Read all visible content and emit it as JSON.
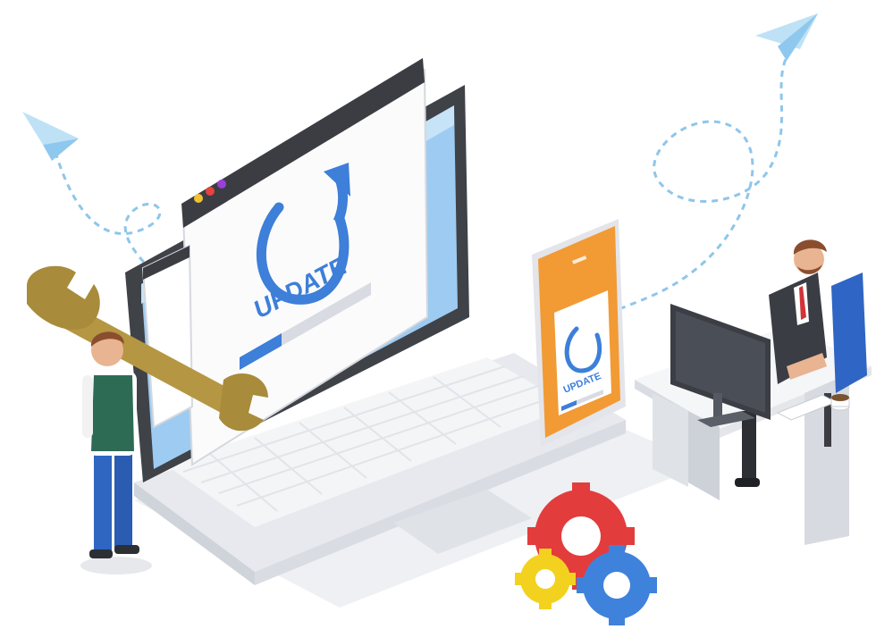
{
  "illustration": {
    "main_window": {
      "label": "UPDATE",
      "progress": 0.32,
      "dots": [
        "#f2c233",
        "#e6433c",
        "#9b3fd6"
      ]
    },
    "phone": {
      "label": "UPDATE",
      "progress": 0.35
    },
    "colors": {
      "accent_blue": "#3d7fd9",
      "light_blue": "#8ec0ee",
      "phone_orange": "#f29a34",
      "gear_red": "#e33c3c",
      "gear_blue": "#3f82dc",
      "gear_yellow": "#f3d21f",
      "wrench": "#b59642"
    },
    "icons": [
      "paper-plane-icon",
      "refresh-arrow-icon",
      "wrench-icon",
      "gear-icon",
      "monitor-icon",
      "coffee-cup-icon"
    ]
  }
}
